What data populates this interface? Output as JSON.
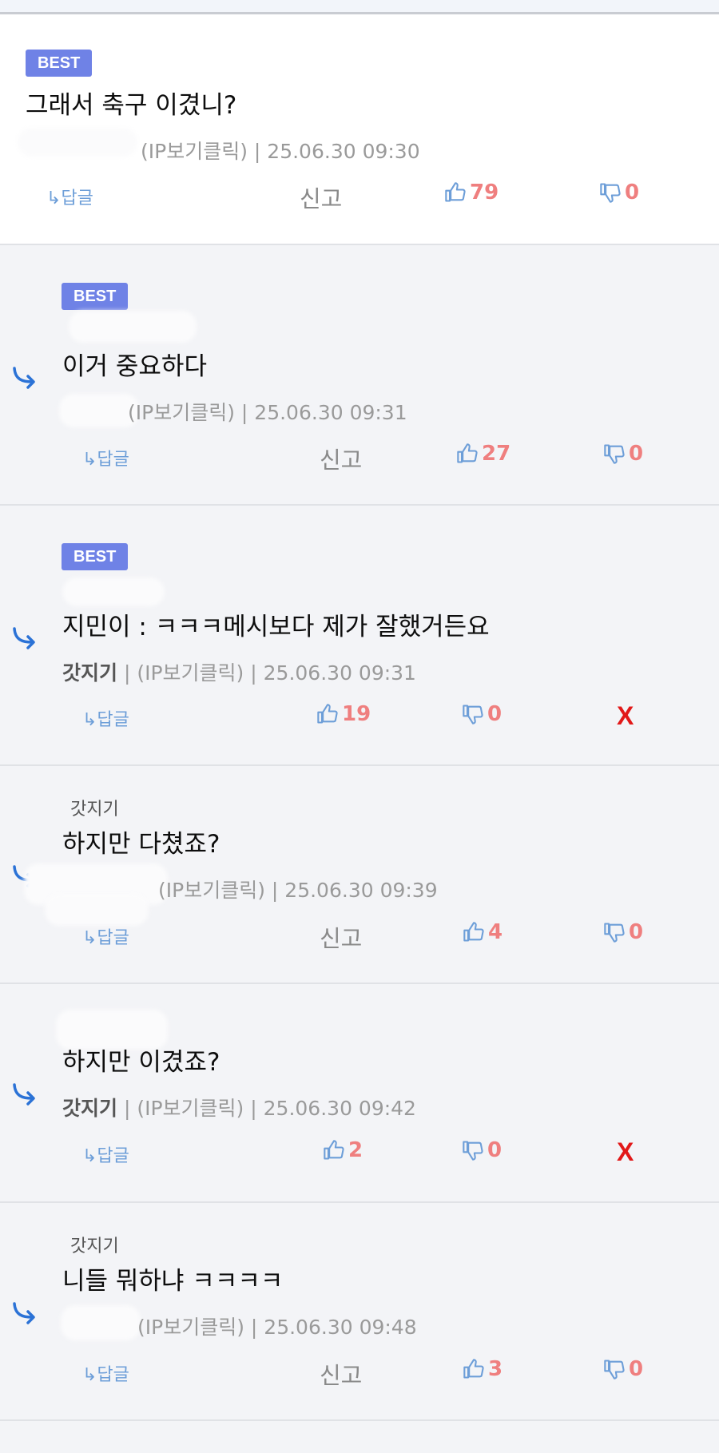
{
  "ip_label": "(IP보기클릭)",
  "reply_label": "↳답글",
  "report_label": "신고",
  "best_label": "BEST",
  "delete_label": "X",
  "comments": [
    {
      "text": "그래서 축구 이겼니?",
      "author": "",
      "time": "25.06.30 09:30",
      "likes": "79",
      "dislikes": "0",
      "parent": ""
    },
    {
      "text": "이거 중요하다",
      "author": "",
      "time": "25.06.30 09:31",
      "likes": "27",
      "dislikes": "0",
      "parent": ""
    },
    {
      "text": "지민이 : ㅋㅋㅋ메시보다 제가 잘했거든요",
      "author": "갓지기",
      "time": "25.06.30 09:31",
      "likes": "19",
      "dislikes": "0",
      "parent": ""
    },
    {
      "text": "하지만 다쳤죠?",
      "author": "",
      "time": "25.06.30 09:39",
      "likes": "4",
      "dislikes": "0",
      "parent": "갓지기"
    },
    {
      "text": "하지만 이겼죠?",
      "author": "갓지기",
      "time": "25.06.30 09:42",
      "likes": "2",
      "dislikes": "0",
      "parent": ""
    },
    {
      "text": "니들 뭐하냐 ㅋㅋㅋㅋ",
      "author": "",
      "time": "25.06.30 09:48",
      "likes": "3",
      "dislikes": "0",
      "parent": "갓지기"
    }
  ]
}
